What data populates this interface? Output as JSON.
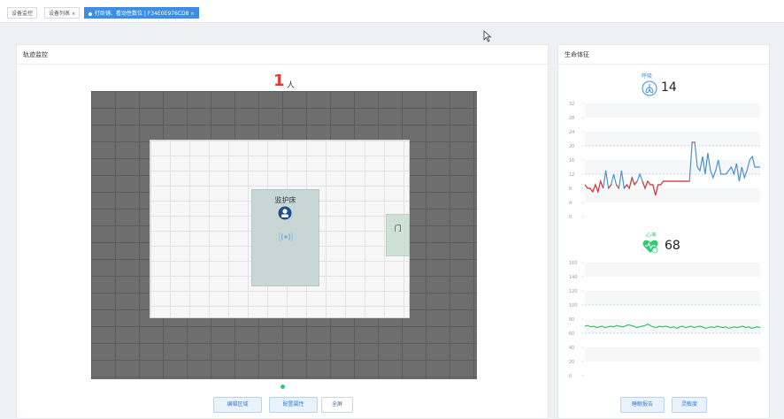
{
  "tabs": [
    {
      "label": "设备监控",
      "active": false
    },
    {
      "label": "设备列表",
      "active": false,
      "caret": "×"
    },
    {
      "label": "打卧铺、看动性数位 | F34E0E976CD8",
      "active": true,
      "caret": "×"
    }
  ],
  "left_panel": {
    "title": "轨迹监控",
    "person_count": "1",
    "person_unit": "人",
    "bed_label": "监护床",
    "door_label": "门",
    "buttons": [
      "编辑区域",
      "配置属性",
      "全屏"
    ]
  },
  "right_panel": {
    "title": "生命体征",
    "breath": {
      "label": "呼吸",
      "value": "14",
      "color": "#3a8ee6"
    },
    "heart": {
      "label": "心率",
      "value": "68",
      "color": "#2ecc71"
    },
    "buttons": [
      "睡眠报告",
      "灵敏度"
    ]
  },
  "chart_data": [
    {
      "type": "line",
      "title": "呼吸",
      "ylim": [
        0,
        32
      ],
      "yticks": [
        "32",
        "28",
        "24",
        "20",
        "16",
        "12",
        "8",
        "4",
        "0"
      ],
      "reference_lines": [
        20,
        12
      ],
      "series": [
        {
          "name": "呼吸",
          "values": [
            9,
            8,
            8,
            7,
            9,
            7,
            10,
            8,
            13,
            8,
            9,
            12,
            9,
            8,
            13,
            8,
            9,
            8,
            11,
            9,
            10,
            12,
            10,
            8,
            10,
            9,
            9,
            6,
            9,
            9,
            10,
            10,
            10,
            10,
            10,
            10,
            10,
            10,
            10,
            10,
            10,
            21,
            21,
            14,
            13,
            17,
            12,
            18,
            13,
            11,
            13,
            16,
            12,
            12,
            12,
            13,
            14,
            12,
            15,
            10,
            14,
            11,
            13,
            16,
            17,
            14,
            14,
            14
          ]
        }
      ],
      "highlight_below": 12,
      "colors": {
        "line": "#4a90d9",
        "low": "#e53935"
      }
    },
    {
      "type": "line",
      "title": "心率",
      "ylim": [
        0,
        160
      ],
      "yticks": [
        "160",
        "140",
        "120",
        "100",
        "80",
        "60",
        "40",
        "20",
        "0"
      ],
      "reference_lines": [
        100,
        60
      ],
      "series": [
        {
          "name": "心率",
          "values": [
            70,
            71,
            69,
            70,
            68,
            69,
            70,
            68,
            69,
            70,
            69,
            71,
            70,
            69,
            70,
            72,
            71,
            70,
            68,
            69,
            70,
            71,
            73,
            70,
            69,
            68,
            70,
            69,
            70,
            69,
            68,
            69,
            67,
            69,
            70,
            68,
            69,
            70,
            68,
            69,
            70,
            69,
            67,
            68,
            69,
            68,
            70,
            69,
            68,
            69,
            67,
            68,
            69,
            68,
            69,
            70,
            68,
            69,
            67,
            68,
            69,
            68
          ]
        }
      ],
      "colors": {
        "line": "#3cbf6b"
      }
    }
  ]
}
